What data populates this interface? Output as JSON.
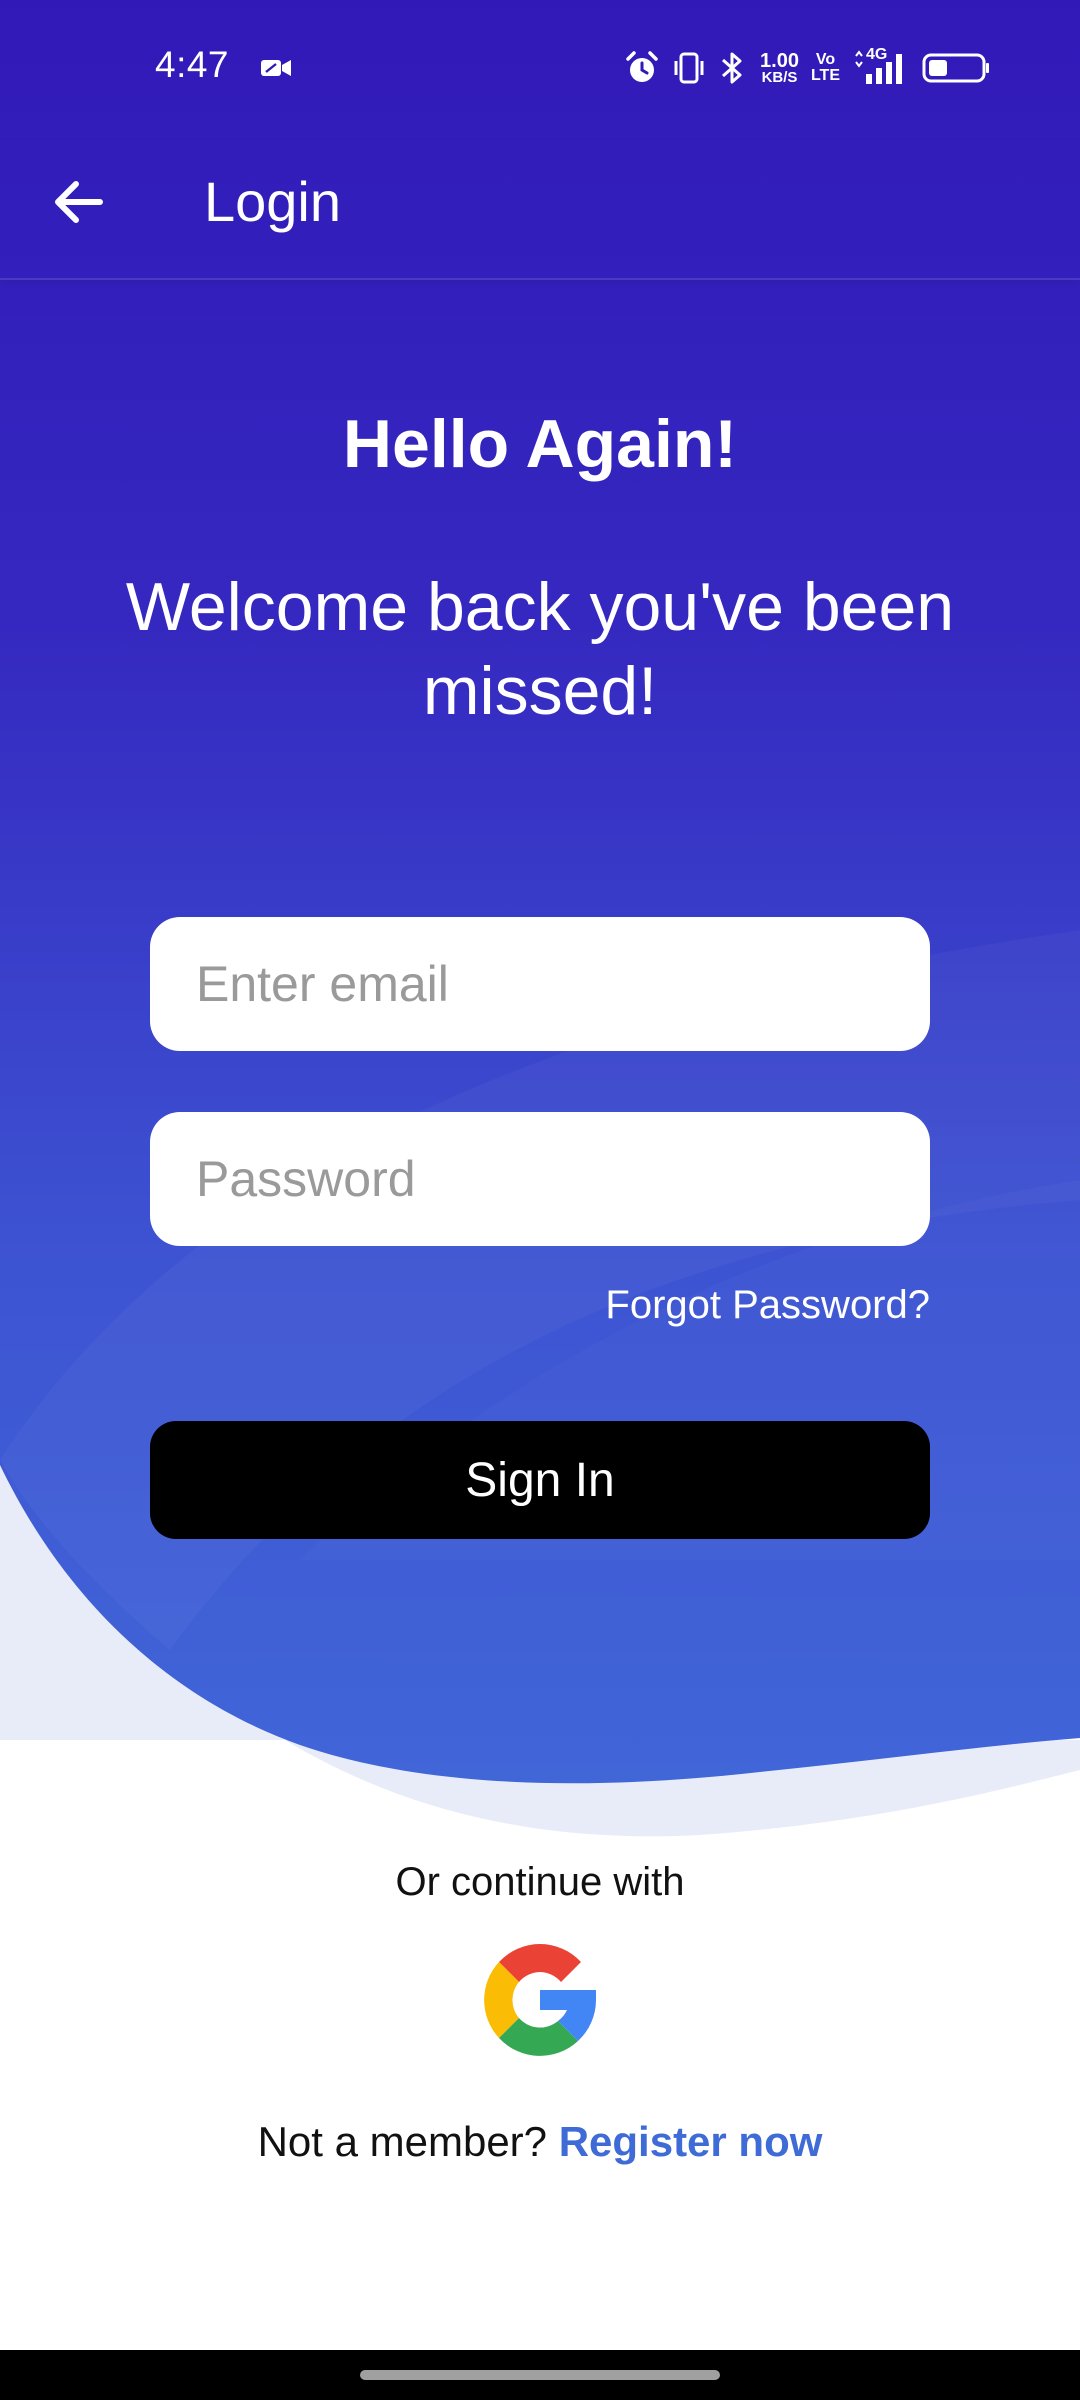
{
  "status_bar": {
    "time": "4:47",
    "net_speed_value": "1.00",
    "net_speed_unit": "KB/S",
    "volte_line1": "Vo",
    "volte_line2": "LTE",
    "network_type": "4G",
    "icons": [
      "video-camera-icon",
      "alarm-icon",
      "vibrate-icon",
      "bluetooth-icon",
      "signal-icon",
      "battery-icon"
    ]
  },
  "app_bar": {
    "title": "Login",
    "back_icon": "arrow-left-icon"
  },
  "hero": {
    "title": "Hello Again!",
    "subtitle": "Welcome back you've been missed!"
  },
  "form": {
    "email_placeholder": "Enter email",
    "email_value": "",
    "password_placeholder": "Password",
    "password_value": "",
    "forgot_label": "Forgot Password?",
    "signin_label": "Sign In"
  },
  "social": {
    "continue_text": "Or continue with",
    "google_icon": "google-logo-icon"
  },
  "register": {
    "prompt": "Not a member?",
    "link_label": "Register now"
  },
  "colors": {
    "gradient_top": "#3119b8",
    "gradient_bottom": "#4166d8",
    "wave_light": "#e8ecf9",
    "link_blue": "#3f6bd6",
    "signin_bg": "#000000"
  }
}
